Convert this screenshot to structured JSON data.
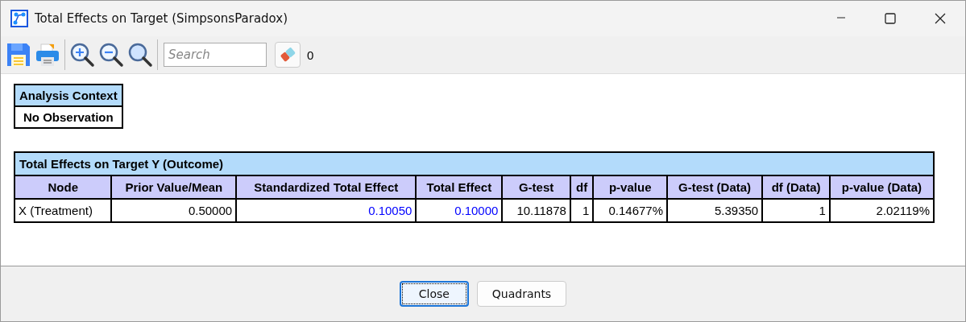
{
  "window": {
    "title": "Total Effects on Target (SimpsonsParadox)"
  },
  "toolbar": {
    "search": {
      "placeholder": "Search"
    },
    "count": "0"
  },
  "context": {
    "header": "Analysis Context",
    "value": "No Observation"
  },
  "table": {
    "title": "Total Effects on Target Y (Outcome)",
    "columns": [
      "Node",
      "Prior Value/Mean",
      "Standardized Total Effect",
      "Total Effect",
      "G-test",
      "df",
      "p-value",
      "G-test (Data)",
      "df (Data)",
      "p-value (Data)"
    ],
    "rows": [
      {
        "cells": [
          {
            "text": "X (Treatment)",
            "color": "#000000"
          },
          {
            "text": "0.50000",
            "color": "#000000"
          },
          {
            "text": "0.10050",
            "color": "#0000ff"
          },
          {
            "text": "0.10000",
            "color": "#0000ff"
          },
          {
            "text": "10.11878",
            "color": "#000000"
          },
          {
            "text": "1",
            "color": "#000000"
          },
          {
            "text": "0.14677%",
            "color": "#000000"
          },
          {
            "text": "5.39350",
            "color": "#000000"
          },
          {
            "text": "1",
            "color": "#000000"
          },
          {
            "text": "2.02119%",
            "color": "#000000"
          }
        ]
      }
    ]
  },
  "buttons": [
    {
      "label": "Close",
      "focused": true
    },
    {
      "label": "Quadrants",
      "focused": false
    }
  ]
}
